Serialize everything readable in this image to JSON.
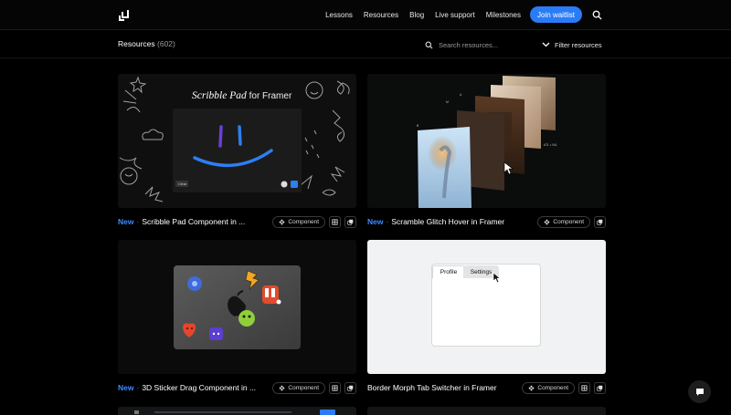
{
  "nav": {
    "links": [
      "Lessons",
      "Resources",
      "Blog",
      "Live support",
      "Milestones"
    ],
    "join_label": "Join waitlist"
  },
  "header": {
    "title": "Resources",
    "count": "(602)",
    "search_placeholder": "Search resources...",
    "filter_label": "Filter resources"
  },
  "cards": [
    {
      "new_label": "New",
      "title": "Scribble Pad Component in ...",
      "tag": "Component",
      "thumb_title": "Scribble Pad",
      "thumb_title_suffix": "for Framer",
      "thumb_button": "Clear"
    },
    {
      "new_label": "New",
      "title": "Scramble Glitch Hover in Framer",
      "tag": "Component"
    },
    {
      "new_label": "New",
      "title": "3D Sticker Drag Component in ...",
      "tag": "Component"
    },
    {
      "title": "Border Morph Tab Switcher in Framer",
      "tag": "Component",
      "tab1": "Profile",
      "tab2": "Settings"
    }
  ],
  "colors": {
    "accent": "#2a7cf6",
    "new_tag": "#3b8bff",
    "background": "#000000"
  }
}
